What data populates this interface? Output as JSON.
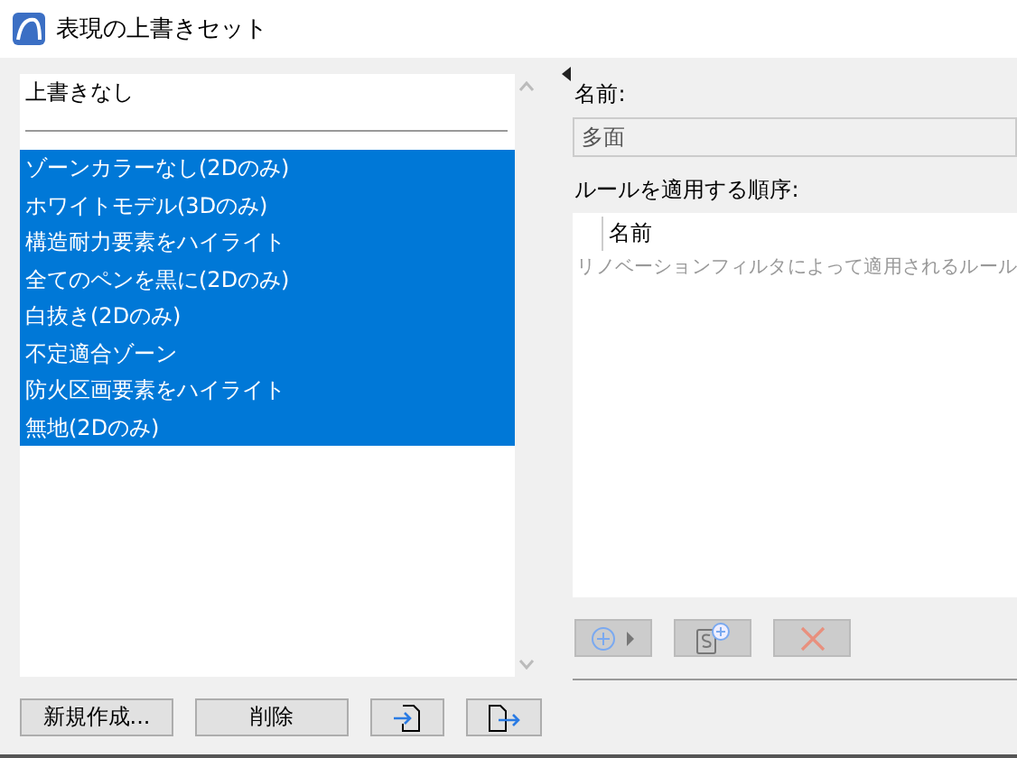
{
  "window": {
    "title": "表現の上書きセット"
  },
  "sets": [
    {
      "label": "上書きなし",
      "selected": false
    },
    {
      "label": "ゾーンカラーなし(2Dのみ)",
      "selected": true
    },
    {
      "label": "ホワイトモデル(3Dのみ)",
      "selected": true
    },
    {
      "label": "構造耐力要素をハイライト",
      "selected": true
    },
    {
      "label": "全てのペンを黒に(2Dのみ)",
      "selected": true
    },
    {
      "label": "白抜き(2Dのみ)",
      "selected": true
    },
    {
      "label": "不定適合ゾーン",
      "selected": true
    },
    {
      "label": "防火区画要素をハイライト",
      "selected": true
    },
    {
      "label": "無地(2Dのみ)",
      "selected": true
    }
  ],
  "buttons": {
    "new": "新規作成...",
    "delete": "削除"
  },
  "name_label": "名前:",
  "name_value": "多面",
  "rules_label": "ルールを適用する順序:",
  "rules_table": {
    "column": "名前",
    "hint": "リノベーションフィルタによって適用されるルール"
  }
}
